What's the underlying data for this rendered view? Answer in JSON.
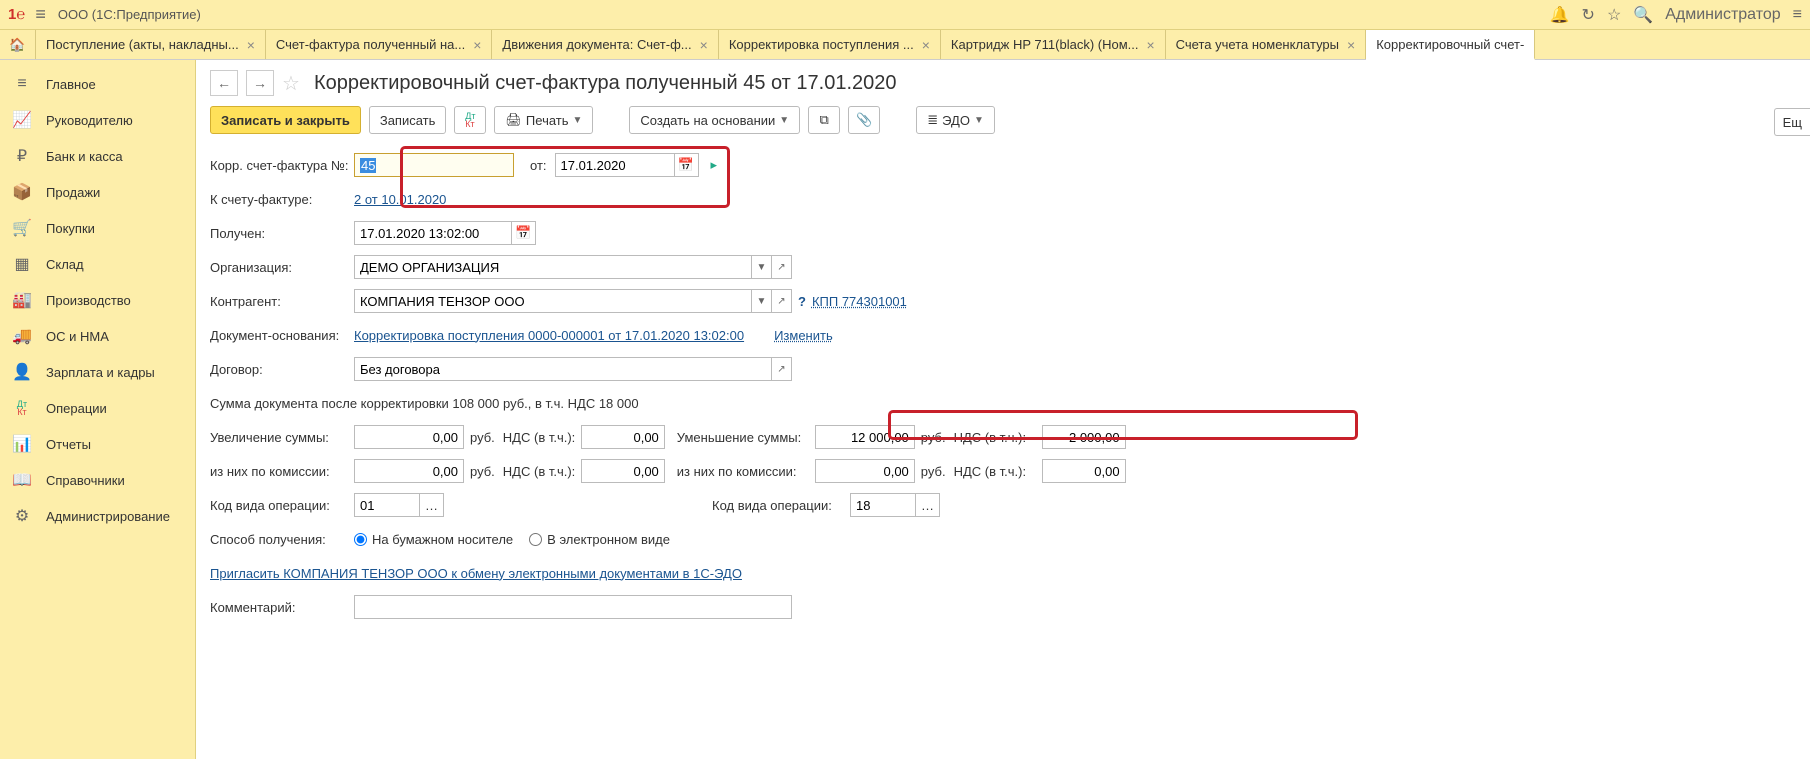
{
  "header": {
    "company": "ООО (1С:Предприятие)",
    "user": "Администратор"
  },
  "tabs": [
    {
      "label": "Поступление (акты, накладны..."
    },
    {
      "label": "Счет-фактура полученный на..."
    },
    {
      "label": "Движения документа: Счет-ф..."
    },
    {
      "label": "Корректировка поступления ..."
    },
    {
      "label": "Картридж HP 711(black) (Ном..."
    },
    {
      "label": "Счета учета номенклатуры"
    },
    {
      "label": "Корректировочный счет-"
    }
  ],
  "sidebar": [
    {
      "icon": "≡",
      "label": "Главное"
    },
    {
      "icon": "📈",
      "label": "Руководителю"
    },
    {
      "icon": "₽",
      "label": "Банк и касса"
    },
    {
      "icon": "📦",
      "label": "Продажи"
    },
    {
      "icon": "🛒",
      "label": "Покупки"
    },
    {
      "icon": "▦",
      "label": "Склад"
    },
    {
      "icon": "🏭",
      "label": "Производство"
    },
    {
      "icon": "🚚",
      "label": "ОС и НМА"
    },
    {
      "icon": "👤",
      "label": "Зарплата и кадры"
    },
    {
      "icon": "Дт",
      "label": "Операции"
    },
    {
      "icon": "📊",
      "label": "Отчеты"
    },
    {
      "icon": "📖",
      "label": "Справочники"
    },
    {
      "icon": "⚙",
      "label": "Администрирование"
    }
  ],
  "page": {
    "title": "Корректировочный счет-фактура полученный 45 от 17.01.2020",
    "toolbar": {
      "save_close": "Записать и закрыть",
      "save": "Записать",
      "print": "Печать",
      "create_based": "Создать на основании",
      "edo": "ЭДО",
      "more": "Ещ"
    },
    "form": {
      "number_label": "Корр. счет-фактура №:",
      "number_value": "45",
      "from_label": "от:",
      "from_date": "17.01.2020",
      "to_invoice_label": "К счету-фактуре:",
      "to_invoice_link": "2 от 10.01.2020",
      "received_label": "Получен:",
      "received_value": "17.01.2020 13:02:00",
      "org_label": "Организация:",
      "org_value": "ДЕМО ОРГАНИЗАЦИЯ",
      "counterparty_label": "Контрагент:",
      "counterparty_value": "КОМПАНИЯ ТЕНЗОР ООО",
      "kpp_link": "КПП 774301001",
      "basis_label": "Документ-основания:",
      "basis_link": "Корректировка поступления 0000-000001 от 17.01.2020 13:02:00",
      "change_link": "Изменить",
      "contract_label": "Договор:",
      "contract_value": "Без договора",
      "summary": "Сумма документа после корректировки 108 000 руб., в т.ч. НДС 18 000",
      "increase_label": "Увеличение суммы:",
      "increase_value": "0,00",
      "rub": "руб.",
      "vat_label": "НДС (в т.ч.):",
      "increase_vat": "0,00",
      "decrease_label": "Уменьшение суммы:",
      "decrease_value": "12 000,00",
      "decrease_vat": "2 000,00",
      "commission_label": "из них по комиссии:",
      "comm_inc": "0,00",
      "comm_inc_vat": "0,00",
      "comm_dec": "0,00",
      "comm_dec_vat": "0,00",
      "opcode_label": "Код вида операции:",
      "opcode1": "01",
      "opcode2": "18",
      "method_label": "Способ получения:",
      "radio_paper": "На бумажном носителе",
      "radio_electronic": "В электронном виде",
      "invite_link": "Пригласить КОМПАНИЯ ТЕНЗОР ООО к обмену электронными документами в 1С-ЭДО",
      "comment_label": "Комментарий:"
    }
  }
}
